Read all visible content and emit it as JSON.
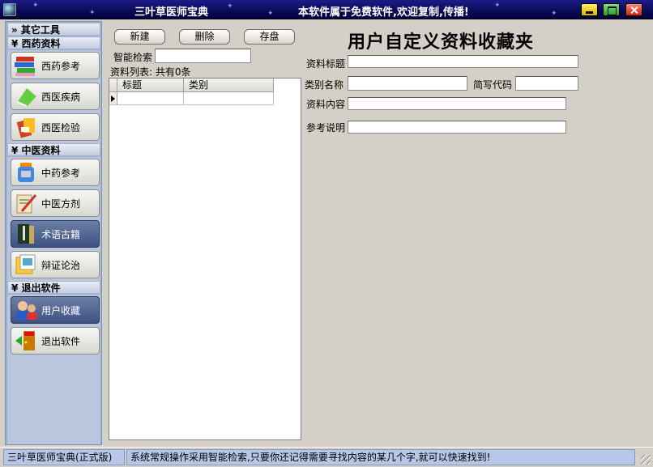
{
  "window": {
    "title": "三叶草医师宝典",
    "slogan": "本软件属于免费软件,欢迎复制,传播!",
    "buttons": {
      "minimize": "minimize",
      "maximize": "maximize",
      "close": "close"
    }
  },
  "sidebar": {
    "groups": [
      {
        "label": "» 其它工具",
        "items": []
      },
      {
        "label": "¥ 西药资料",
        "items": [
          {
            "label": "西药参考",
            "icon": "books-icon"
          },
          {
            "label": "西医疾病",
            "icon": "notebook-icon"
          },
          {
            "label": "西医检验",
            "icon": "lab-icon"
          }
        ]
      },
      {
        "label": "¥ 中医资料",
        "items": [
          {
            "label": "中药参考",
            "icon": "herb-jar-icon"
          },
          {
            "label": "中医方剂",
            "icon": "prescription-icon"
          },
          {
            "label": "术语古籍",
            "icon": "ancient-book-icon",
            "active": true
          },
          {
            "label": "辩证论治",
            "icon": "diagnosis-icon"
          }
        ]
      },
      {
        "label": "¥ 退出软件",
        "items": [
          {
            "label": "用户收藏",
            "icon": "user-collection-icon",
            "active": true
          },
          {
            "label": "退出软件",
            "icon": "exit-door-icon"
          }
        ]
      }
    ]
  },
  "toolbar": {
    "new_label": "新建",
    "delete_label": "删除",
    "save_label": "存盘"
  },
  "search": {
    "label": "智能检索",
    "value": ""
  },
  "list": {
    "summary": "资料列表:  共有0条",
    "columns": [
      "标题",
      "类别"
    ],
    "rows": []
  },
  "form": {
    "title": "用户自定义资料收藏夹",
    "fields": {
      "title_label": "资料标题",
      "title_value": "",
      "category_label": "类别名称",
      "category_value": "",
      "code_label": "简写代码",
      "code_value": "",
      "content_label": "资料内容",
      "content_value": "",
      "notes_label": "参考说明",
      "notes_value": ""
    }
  },
  "status": {
    "edition": "三叶草医师宝典(正式版)",
    "tip": "系统常规操作采用智能检索,只要你还记得需要寻找内容的某几个字,就可以快速找到!"
  }
}
